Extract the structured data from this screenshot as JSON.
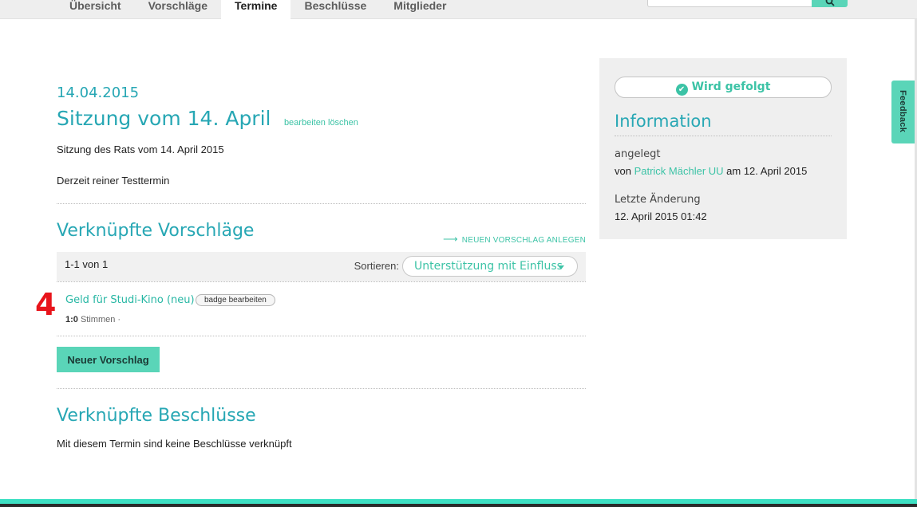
{
  "nav": {
    "tabs": [
      {
        "label": "Übersicht"
      },
      {
        "label": "Vorschläge"
      },
      {
        "label": "Termine"
      },
      {
        "label": "Beschlüsse"
      },
      {
        "label": "Mitglieder"
      }
    ],
    "active_tab": "Termine",
    "search_icon": "search-icon"
  },
  "event": {
    "date": "14.04.2015",
    "title": "Sitzung vom 14. April",
    "edit_label": "bearbeiten",
    "delete_label": "löschen",
    "subtitle": "Sitzung des Rats vom 14. April 2015",
    "description": "Derzeit reiner Testtermin"
  },
  "proposals": {
    "section_title": "Verknüpfte Vorschläge",
    "new_link": "NEUEN VORSCHLAG ANLEGEN",
    "count": "1-1 von 1",
    "sort_label": "Sortieren:",
    "sort_value": "Unterstützung mit Einfluss",
    "items": [
      {
        "number": "4",
        "title": "Geld für Studi-Kino (neu)",
        "badge_button": "badge bearbeiten",
        "votes_bold": "1:0",
        "votes_text": " Stimmen ·"
      }
    ],
    "new_button": "Neuer Vorschlag"
  },
  "decisions": {
    "section_title": "Verknüpfte Beschlüsse",
    "empty_text": "Mit diesem Termin sind keine Beschlüsse verknüpft"
  },
  "sidebar": {
    "follow_button": "Wird gefolgt",
    "info_title": "Information",
    "created_label": "angelegt",
    "created_prefix": "von ",
    "created_author": "Patrick Mächler UU",
    "created_suffix": " am 12. April 2015",
    "modified_label": "Letzte Änderung",
    "modified_value": "12. April 2015 01:42"
  },
  "feedback_tab": "Feedback",
  "colors": {
    "accent": "#27a7b4",
    "brand_green": "#5ad5b8",
    "link_green": "#3cc3a6",
    "number_red": "#e8141b"
  }
}
